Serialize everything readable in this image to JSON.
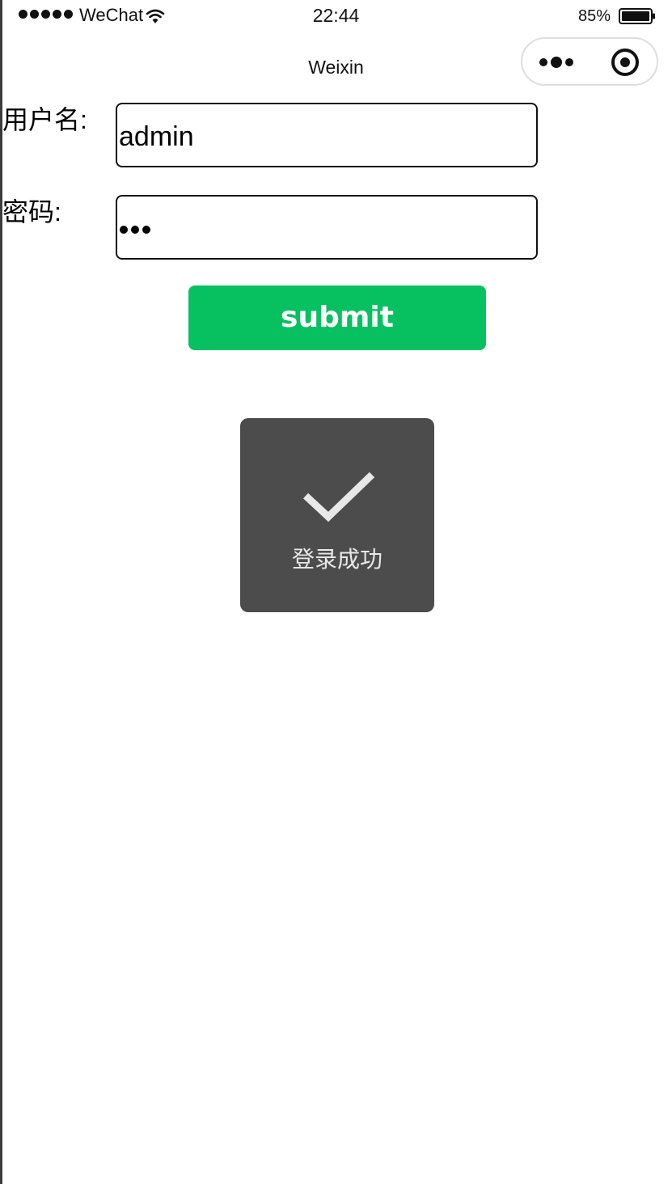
{
  "status_bar": {
    "carrier": "WeChat",
    "time": "22:44",
    "battery": "85%",
    "battery_level": 0.85
  },
  "nav": {
    "title": "Weixin"
  },
  "form": {
    "username_label": "用户名:",
    "username_value": "admin",
    "password_label": "密码:",
    "password_length": 3,
    "submit_label": "submit"
  },
  "toast": {
    "icon": "checkmark-icon",
    "message": "登录成功"
  },
  "colors": {
    "primary": "#07c160",
    "toast_bg": "#4c4c4c"
  }
}
